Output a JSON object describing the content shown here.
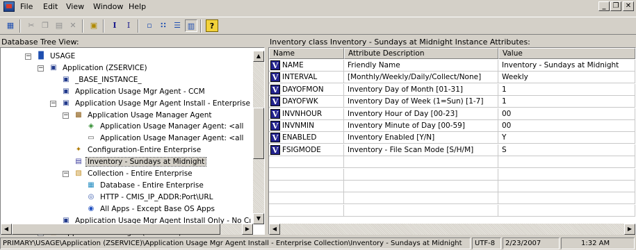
{
  "menubar": {
    "items": [
      "File",
      "Edit",
      "View",
      "Window",
      "Help"
    ],
    "window_controls": [
      "_",
      "❐",
      "✕"
    ]
  },
  "toolbar": {
    "buttons": [
      {
        "icon": "open-icon",
        "glyph": "▦",
        "enabled": true
      },
      {
        "icon": "cut-icon",
        "glyph": "✂",
        "enabled": false
      },
      {
        "icon": "copy-icon",
        "glyph": "❐",
        "enabled": false
      },
      {
        "icon": "paste-icon",
        "glyph": "▤",
        "enabled": false
      },
      {
        "icon": "delete-icon",
        "glyph": "✕",
        "enabled": false
      },
      {
        "icon": "folder-icon",
        "glyph": "▣",
        "enabled": true
      },
      {
        "icon": "bold-i-icon",
        "glyph": "I",
        "enabled": true
      },
      {
        "icon": "small-i-icon",
        "glyph": "I",
        "enabled": true
      },
      {
        "icon": "large-icons-view-icon",
        "glyph": "▫",
        "enabled": true
      },
      {
        "icon": "small-icons-view-icon",
        "glyph": "∷",
        "enabled": true
      },
      {
        "icon": "list-view-icon",
        "glyph": "☰",
        "enabled": true
      },
      {
        "icon": "details-view-icon",
        "glyph": "▥",
        "enabled": true
      },
      {
        "icon": "help-icon",
        "glyph": "?",
        "enabled": true
      }
    ]
  },
  "tree_panel": {
    "title": "Database Tree View:",
    "items": [
      {
        "label": "USAGE",
        "icon": "chart-icon",
        "depth": 2,
        "expander": "−"
      },
      {
        "label": "Application (ZSERVICE)",
        "icon": "application-icon",
        "depth": 3,
        "expander": "−"
      },
      {
        "label": "_BASE_INSTANCE_",
        "icon": "application-icon",
        "depth": 4,
        "expander": ""
      },
      {
        "label": "Application Usage Mgr Agent - CCM",
        "icon": "application-icon",
        "depth": 4,
        "expander": ""
      },
      {
        "label": "Application Usage Mgr Agent Install - Enterprise",
        "icon": "application-icon",
        "depth": 4,
        "expander": "−"
      },
      {
        "label": "Application  Usage Manager Agent",
        "icon": "package-icon",
        "depth": 5,
        "expander": "−"
      },
      {
        "label": "Application  Usage Manager Agent: <all",
        "icon": "connector-icon",
        "depth": 6,
        "expander": ""
      },
      {
        "label": "Application  Usage Manager Agent: <all",
        "icon": "drive-icon",
        "depth": 6,
        "expander": ""
      },
      {
        "label": "Configuration-Entire Enterprise",
        "icon": "config-icon",
        "depth": 5,
        "expander": ""
      },
      {
        "label": "Inventory - Sundays at Midnight",
        "icon": "inventory-icon",
        "depth": 5,
        "expander": "",
        "selected": true
      },
      {
        "label": "Collection - Entire Enterprise",
        "icon": "collection-icon",
        "depth": 5,
        "expander": "−"
      },
      {
        "label": "Database - Entire Enterprise",
        "icon": "database-icon",
        "depth": 6,
        "expander": ""
      },
      {
        "label": "HTTP - CMIS_IP_ADDR:Port\\URL",
        "icon": "http-icon",
        "depth": 6,
        "expander": ""
      },
      {
        "label": "All Apps - Except Base OS Apps",
        "icon": "apps-icon",
        "depth": 6,
        "expander": ""
      },
      {
        "label": "Application Usage Mgr Agent Install Only - No Cı",
        "icon": "application-icon",
        "depth": 4,
        "expander": ""
      },
      {
        "label": "Application Packages (PACKAGE)",
        "icon": "package-icon",
        "depth": 3,
        "expander": "+"
      }
    ]
  },
  "grid_panel": {
    "title": "Inventory class Inventory - Sundays at Midnight Instance Attributes:",
    "columns": [
      "Name",
      "Attribute Description",
      "Value"
    ],
    "rows": [
      {
        "badge": "V",
        "name": "NAME",
        "description": "Friendly Name",
        "value": "Inventory - Sundays at Midnight"
      },
      {
        "badge": "V",
        "name": "INTERVAL",
        "description": "[Monthly/Weekly/Daily/Collect/None]",
        "value": "Weekly"
      },
      {
        "badge": "V",
        "name": "DAYOFMON",
        "description": "Inventory Day of Month [01-31]",
        "value": "1"
      },
      {
        "badge": "V",
        "name": "DAYOFWK",
        "description": "Inventory Day of Week (1=Sun) [1-7]",
        "value": "1"
      },
      {
        "badge": "V",
        "name": "INVNHOUR",
        "description": "Inventory Hour of Day [00-23]",
        "value": "00"
      },
      {
        "badge": "V",
        "name": "INVNMIN",
        "description": "Inventory Minute of Day [00-59]",
        "value": "00"
      },
      {
        "badge": "V",
        "name": "ENABLED",
        "description": "Inventory Enabled [Y/N]",
        "value": "Y"
      },
      {
        "badge": "V",
        "name": "FSIGMODE",
        "description": "Inventory - File Scan Mode [S/H/M]",
        "value": "S"
      }
    ]
  },
  "statusbar": {
    "path": "PRIMARY\\USAGE\\Application (ZSERVICE)\\Application Usage Mgr Agent Install - Enterprise Collection\\Inventory - Sundays at Midnight",
    "encoding": "UTF-8",
    "date": "2/23/2007",
    "time": "1:32 AM"
  }
}
